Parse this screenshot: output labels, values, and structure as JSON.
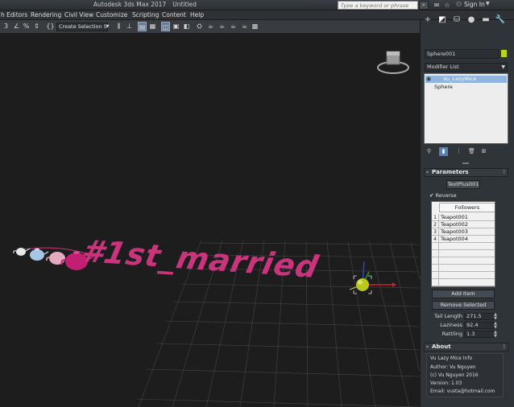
{
  "window": {
    "app_title": "Autodesk 3ds Max 2017",
    "doc_title": "Untitled",
    "search_placeholder": "Type a keyword or phrase",
    "sign_in": "Sign In"
  },
  "menus": [
    "h Editors",
    "Rendering",
    "Civil View",
    "Customize",
    "Scripting",
    "Content",
    "Help"
  ],
  "toolbar": {
    "selection_set": "Create Selection Se"
  },
  "viewport": {
    "text_object": "#1st_married"
  },
  "command_panel": {
    "object_name": "Sphere001",
    "object_color": "#bcd41c",
    "modifier_list_label": "Modifier List",
    "stack": [
      "Vu_LazyMice",
      "Sphere"
    ],
    "parameters": {
      "title": "Parameters",
      "pick_button": "TextPlus001",
      "reverse_label": "Reverse",
      "followers_header": "Followers",
      "followers": [
        {
          "index": "1",
          "name": "Teapot001"
        },
        {
          "index": "2",
          "name": "Teapot002"
        },
        {
          "index": "3",
          "name": "Teapot003"
        },
        {
          "index": "4",
          "name": "Teapot004"
        }
      ],
      "add_item": "Add Item",
      "remove_selected": "Remove Selected",
      "tail_length_label": "Tail Length",
      "tail_length_value": "271.5",
      "laziness_label": "Laziness",
      "laziness_value": "92.4",
      "rattling_label": "Rattling",
      "rattling_value": "1.3"
    },
    "about": {
      "title": "About",
      "lines": [
        "Vu Lazy Mice Info",
        "Author: Vu Nguyen",
        "(c) Vu Nguyen 2016",
        "Version: 1.03",
        "Email: vusta@hotmail.com"
      ]
    }
  }
}
